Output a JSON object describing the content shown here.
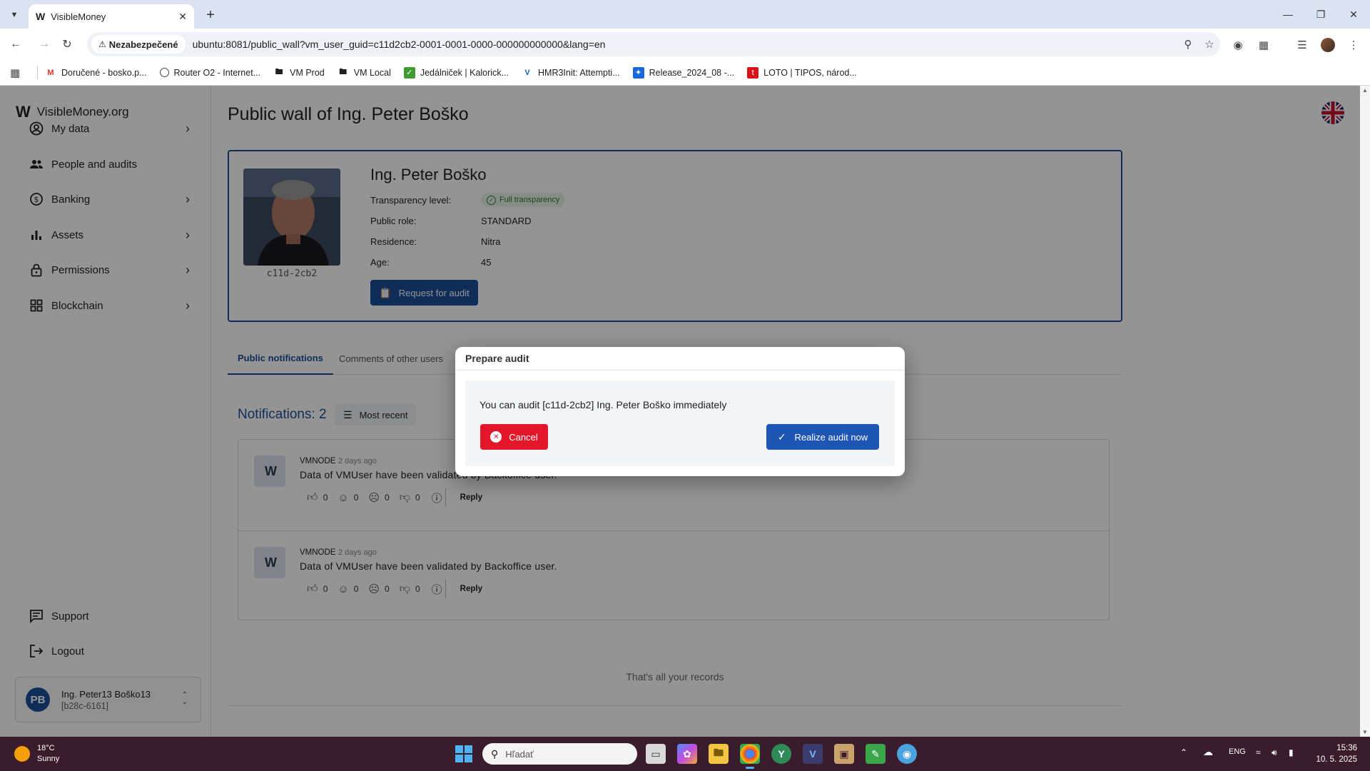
{
  "browser": {
    "tab_title": "VisibleMoney",
    "tab_favicon": "W",
    "security_label": "Nezabezpečené",
    "url": "ubuntu:8081/public_wall?vm_user_guid=c11d2cb2-0001-0001-0000-000000000000&lang=en",
    "bookmarks": [
      {
        "label": "Doručené - bosko.p...",
        "icon": "gmail-icon"
      },
      {
        "label": "Router O2 - Internet...",
        "icon": "globe-icon"
      },
      {
        "label": "VM Prod",
        "icon": "folder-icon"
      },
      {
        "label": "VM Local",
        "icon": "folder-icon"
      },
      {
        "label": "Jedálniček | Kalorick...",
        "icon": "kaloricke-icon"
      },
      {
        "label": "HMR3Init: Attempti...",
        "icon": "virtualbox-icon"
      },
      {
        "label": "Release_2024_08 -...",
        "icon": "jira-icon"
      },
      {
        "label": "LOTO | TIPOS, národ...",
        "icon": "tipos-icon"
      }
    ]
  },
  "sidebar": {
    "brand": "VisibleMoney.org",
    "items": [
      {
        "label": "My data",
        "icon": "account-circle-icon",
        "has_chevron": true
      },
      {
        "label": "People and audits",
        "icon": "people-icon",
        "has_chevron": false
      },
      {
        "label": "Banking",
        "icon": "banking-icon",
        "has_chevron": true
      },
      {
        "label": "Assets",
        "icon": "bar-chart-icon",
        "has_chevron": true
      },
      {
        "label": "Permissions",
        "icon": "lock-icon",
        "has_chevron": true
      },
      {
        "label": "Blockchain",
        "icon": "grid-icon",
        "has_chevron": true
      }
    ],
    "support": "Support",
    "logout": "Logout",
    "user": {
      "initials": "PB",
      "name": "Ing. Peter13 Boško13",
      "guid": "[b28c-6161]"
    }
  },
  "main": {
    "page_title": "Public wall of Ing. Peter Boško",
    "profile": {
      "name": "Ing. Peter Boško",
      "guid_short": "c11d-2cb2",
      "fields": [
        {
          "label": "Transparency level:",
          "value": "Full transparency"
        },
        {
          "label": "Public role:",
          "value": "STANDARD"
        },
        {
          "label": "Residence:",
          "value": "Nitra"
        },
        {
          "label": "Age:",
          "value": "45"
        }
      ],
      "request_audit": "Request for audit"
    },
    "tabs": [
      {
        "label": "Public notifications",
        "active": true
      },
      {
        "label": "Comments of other users",
        "active": false
      }
    ],
    "notifications_count": "Notifications: 2",
    "sort_label": "Most recent",
    "notifications": [
      {
        "author": "VMNODE",
        "time": "2 days ago",
        "text": "Data of VMUser have been validated by Backoffice user.",
        "likes": "0",
        "smiles": "0",
        "frowns": "0",
        "dislikes": "0",
        "reply": "Reply"
      },
      {
        "author": "VMNODE",
        "time": "2 days ago",
        "text": "Data of VMUser have been validated by Backoffice user.",
        "likes": "0",
        "smiles": "0",
        "frowns": "0",
        "dislikes": "0",
        "reply": "Reply"
      }
    ],
    "end_note": "That's all your records"
  },
  "modal": {
    "title": "Prepare audit",
    "message": "You can audit [c11d-2cb2] Ing. Peter Boško immediately",
    "cancel": "Cancel",
    "confirm": "Realize audit now"
  },
  "taskbar": {
    "temp": "18°C",
    "weather": "Sunny",
    "search_placeholder": "Hľadať",
    "lang": "ENG",
    "time": "15:36",
    "date": "10. 5. 2025"
  },
  "colors": {
    "primary": "#1d4e9b",
    "danger": "#e4162a",
    "success": "#2e7d32"
  }
}
